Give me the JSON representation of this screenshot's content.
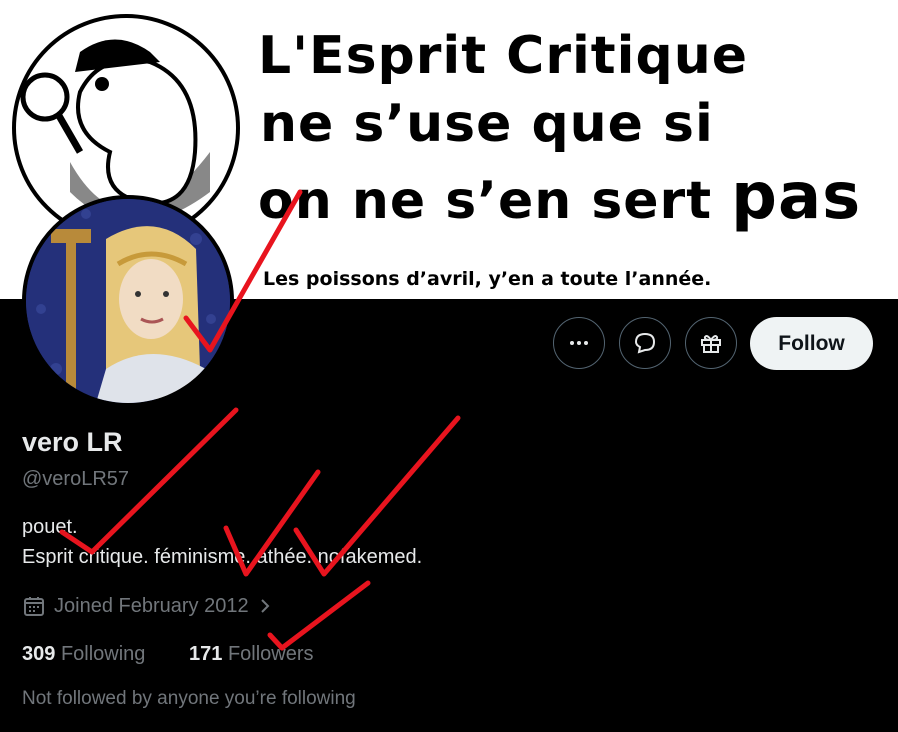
{
  "banner": {
    "line1": "L'Esprit Critique",
    "line2": "ne s’use que si",
    "line3": "on ne s’en sert",
    "line3_big": "pas",
    "subtitle": "Les poissons d’avril, y’en a toute l’année."
  },
  "actions": {
    "more_icon": "more-dots-icon",
    "message_icon": "message-bubble-icon",
    "gift_icon": "gift-icon",
    "follow_label": "Follow"
  },
  "profile": {
    "name": "vero LR",
    "handle": "@veroLR57",
    "bio_line1": "pouet.",
    "bio_line2": "Esprit critique. féminisme. athée. nofakemed.",
    "joined": "Joined February 2012",
    "following_count": "309",
    "following_label": "Following",
    "followers_count": "171",
    "followers_label": "Followers",
    "not_followed": "Not followed by anyone you’re following"
  },
  "colors": {
    "background": "#000000",
    "text_primary": "#e7e9ea",
    "text_secondary": "#71767b",
    "annotation_red": "#e8141e"
  }
}
